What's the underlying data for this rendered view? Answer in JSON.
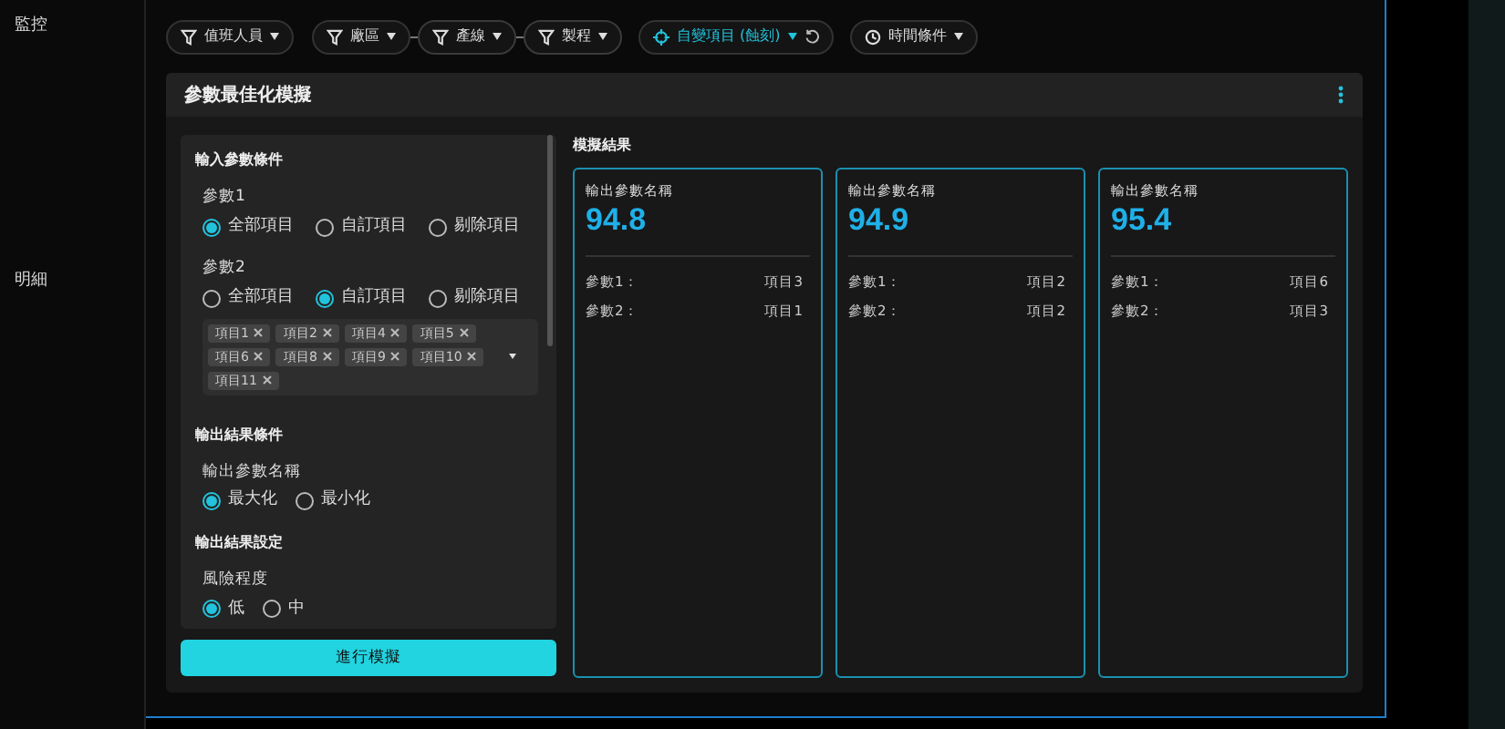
{
  "sidebar": {
    "items": [
      {
        "label": "監控"
      },
      {
        "label": "明細"
      }
    ]
  },
  "filters": [
    {
      "kind": "filter",
      "label": "值班人員",
      "linked": false
    },
    {
      "kind": "filter",
      "label": "廠區",
      "linked": false
    },
    {
      "kind": "filter",
      "label": "產線",
      "linked": true
    },
    {
      "kind": "filter",
      "label": "製程",
      "linked": true
    },
    {
      "kind": "target",
      "label": "自變項目 (蝕刻)",
      "linked": false
    },
    {
      "kind": "time",
      "label": "時間條件",
      "linked": false
    }
  ],
  "panel": {
    "title": "參數最佳化模擬",
    "inputs": {
      "title": "輸入參數條件",
      "params": [
        {
          "label": "參數1",
          "options": [
            {
              "label": "全部項目",
              "selected": true
            },
            {
              "label": "自訂項目",
              "selected": false
            },
            {
              "label": "剔除項目",
              "selected": false
            }
          ]
        },
        {
          "label": "參數2",
          "options": [
            {
              "label": "全部項目",
              "selected": false
            },
            {
              "label": "自訂項目",
              "selected": true
            },
            {
              "label": "剔除項目",
              "selected": false
            }
          ],
          "tags": [
            "項目1",
            "項目2",
            "項目4",
            "項目5",
            "項目6",
            "項目8",
            "項目9",
            "項目10",
            "項目11"
          ]
        }
      ]
    },
    "output_condition": {
      "title": "輸出結果條件",
      "label": "輸出參數名稱",
      "options": [
        {
          "label": "最大化",
          "selected": true
        },
        {
          "label": "最小化",
          "selected": false
        }
      ]
    },
    "output_settings": {
      "title": "輸出結果設定",
      "label": "風險程度",
      "options": [
        {
          "label": "低",
          "selected": true
        },
        {
          "label": "中",
          "selected": false
        }
      ]
    },
    "run_button": "進行模擬",
    "results": {
      "title": "模擬結果",
      "cards": [
        {
          "name": "輸出參數名稱",
          "value": "94.8",
          "rows": [
            {
              "label": "參數1：",
              "value": "項目3"
            },
            {
              "label": "參數2：",
              "value": "項目1"
            }
          ]
        },
        {
          "name": "輸出參數名稱",
          "value": "94.9",
          "rows": [
            {
              "label": "參數1：",
              "value": "項目2"
            },
            {
              "label": "參數2：",
              "value": "項目2"
            }
          ]
        },
        {
          "name": "輸出參數名稱",
          "value": "95.4",
          "rows": [
            {
              "label": "參數1：",
              "value": "項目6"
            },
            {
              "label": "參數2：",
              "value": "項目3"
            }
          ]
        }
      ]
    }
  }
}
